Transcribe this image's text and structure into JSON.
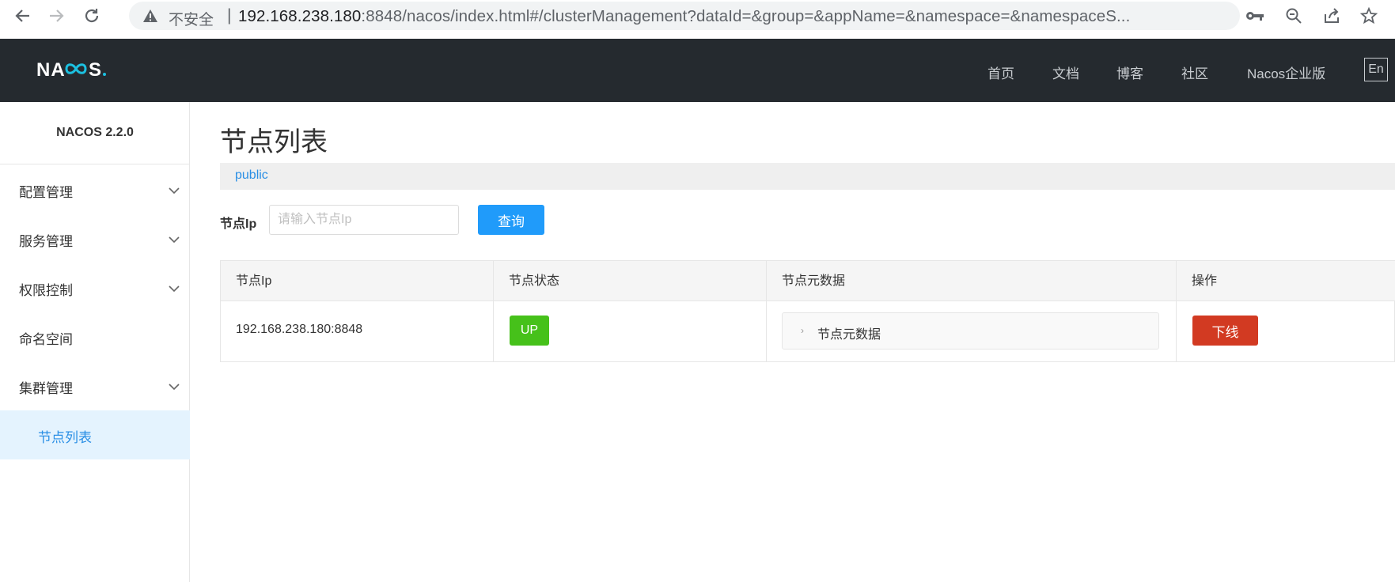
{
  "browser": {
    "insecure_label": "不安全",
    "url_host": "192.168.238.180",
    "url_rest": ":8848/nacos/index.html#/clusterManagement?dataId=&group=&appName=&namespace=&namespaceS..."
  },
  "header": {
    "nav": [
      "首页",
      "文档",
      "博客",
      "社区",
      "Nacos企业版"
    ],
    "lang": "En"
  },
  "sidebar": {
    "version": "NACOS 2.2.0",
    "items": [
      {
        "label": "配置管理"
      },
      {
        "label": "服务管理"
      },
      {
        "label": "权限控制"
      },
      {
        "label": "命名空间"
      },
      {
        "label": "集群管理"
      },
      {
        "label": "节点列表"
      }
    ]
  },
  "main": {
    "title": "节点列表",
    "namespace": "public",
    "search_label": "节点Ip",
    "search_placeholder": "请输入节点Ip",
    "search_button": "查询",
    "table": {
      "headers": [
        "节点Ip",
        "节点状态",
        "节点元数据",
        "操作"
      ],
      "rows": [
        {
          "ip": "192.168.238.180:8848",
          "status": "UP",
          "metadata": "节点元数据",
          "action": "下线"
        }
      ]
    }
  },
  "colors": {
    "header_bg": "#252a2f",
    "primary": "#209bfa",
    "status_up": "#46c11a",
    "danger": "#d23a22"
  }
}
